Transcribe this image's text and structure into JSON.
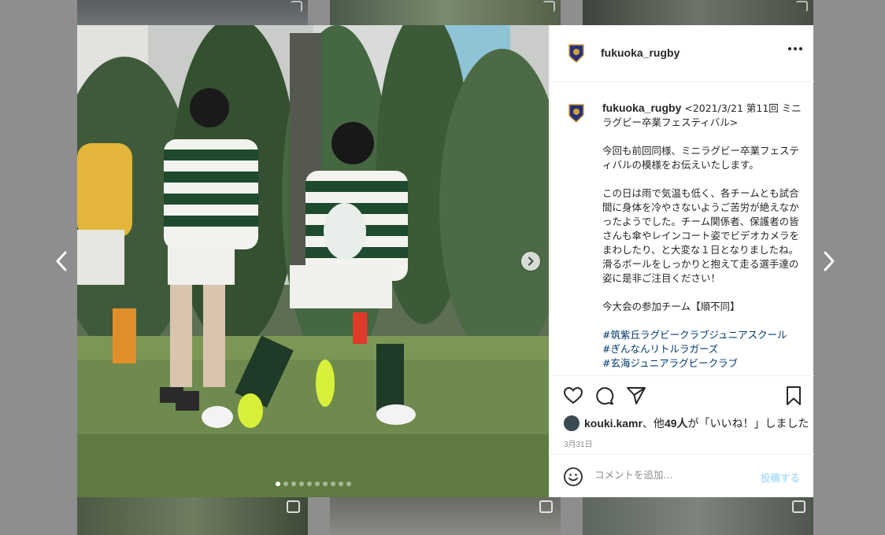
{
  "post": {
    "username": "fukuoka_rugby",
    "caption_title": "<2021/3/21 第11回 ミニラグビー卒業フェスティバル>",
    "caption_p1": "今回も前回同様、ミニラグビー卒業フェスティバルの模様をお伝えいたします。",
    "caption_p2": "この日は雨で気温も低く、各チームとも試合間に身体を冷やさないようご苦労が絶えなかったようでした。チーム関係者、保護者の皆さんも傘やレインコート姿でビデオカメラをまわしたり、と大変な１日となりましたね。滑るボールをしっかりと抱えて走る選手達の姿に是非ご注目ください！",
    "caption_p3": "今大会の参加チーム【順不同】",
    "hashtags": [
      "#筑紫丘ラグビークラブジュニアスクール",
      "#ぎんなんリトルラガーズ",
      "#玄海ジュニアラグビークラブ"
    ],
    "likes_user": "kouki.kamr",
    "likes_mid": "、他",
    "likes_count": "49人",
    "likes_suffix": "が「いいね！」しました",
    "date": "3月31日",
    "comment_placeholder": "コメントを追加...",
    "post_button": "投稿する"
  },
  "carousel": {
    "total": 10,
    "active": 0
  },
  "icons": {
    "heart": "heart-icon",
    "comment": "comment-icon",
    "share": "share-icon",
    "save": "bookmark-icon",
    "emoji": "emoji-icon",
    "more": "more-icon",
    "prev": "chevron-left-icon",
    "next": "chevron-right-icon"
  },
  "colors": {
    "link": "#00376b",
    "post_disabled": "#b2dffc",
    "text": "#262626",
    "muted": "#8e8e8e"
  }
}
